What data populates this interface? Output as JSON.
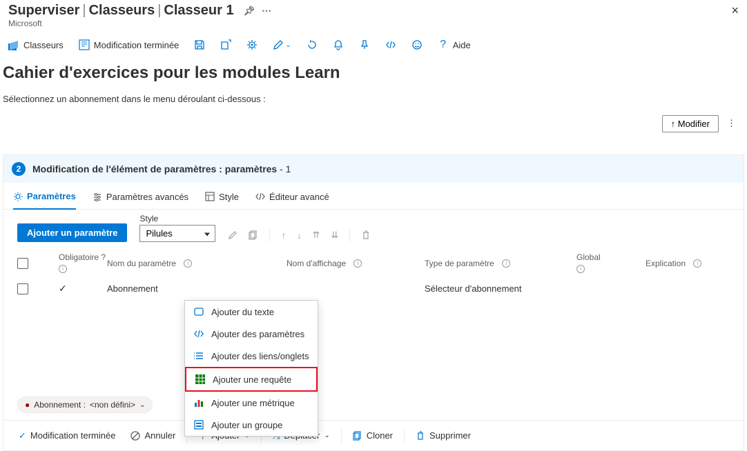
{
  "breadcrumb": {
    "a": "Superviser",
    "b": "Classeurs",
    "c": "Classeur 1"
  },
  "subtitle": "Microsoft",
  "toolbar": {
    "classeurs": "Classeurs",
    "modif_done": "Modification terminée",
    "help": "Aide"
  },
  "main_title": "Cahier d'exercices pour les modules Learn",
  "description": "Sélectionnez un abonnement dans le menu déroulant ci-dessous :",
  "edit_btn": "↑ Modifier",
  "panel": {
    "step": "2",
    "title_a": "Modification de l'élément de paramètres : paramètres",
    "title_b": " - 1"
  },
  "tabs": {
    "params": "Paramètres",
    "adv_params": "Paramètres avancés",
    "style": "Style",
    "adv_editor": "Éditeur avancé"
  },
  "add_param": "Ajouter un paramètre",
  "style_label": "Style",
  "style_value": "Pilules",
  "columns": {
    "required": "Obligatoire ?",
    "param_name": "Nom du paramètre",
    "display_name": "Nom d'affichage",
    "param_type": "Type de paramètre",
    "global": "Global",
    "explanation": "Explication"
  },
  "row": {
    "name": "Abonnement",
    "type": "Sélecteur d'abonnement"
  },
  "menu": {
    "text": "Ajouter du texte",
    "params": "Ajouter des paramètres",
    "links": "Ajouter des liens/onglets",
    "query": "Ajouter une requête",
    "metric": "Ajouter une métrique",
    "group": "Ajouter un groupe"
  },
  "pill": {
    "label": "Abonnement :",
    "value": "<non défini>"
  },
  "bottom": {
    "done": "Modification terminée",
    "cancel": "Annuler",
    "add": "Ajouter",
    "move": "Déplacer",
    "clone": "Cloner",
    "delete": "Supprimer"
  }
}
